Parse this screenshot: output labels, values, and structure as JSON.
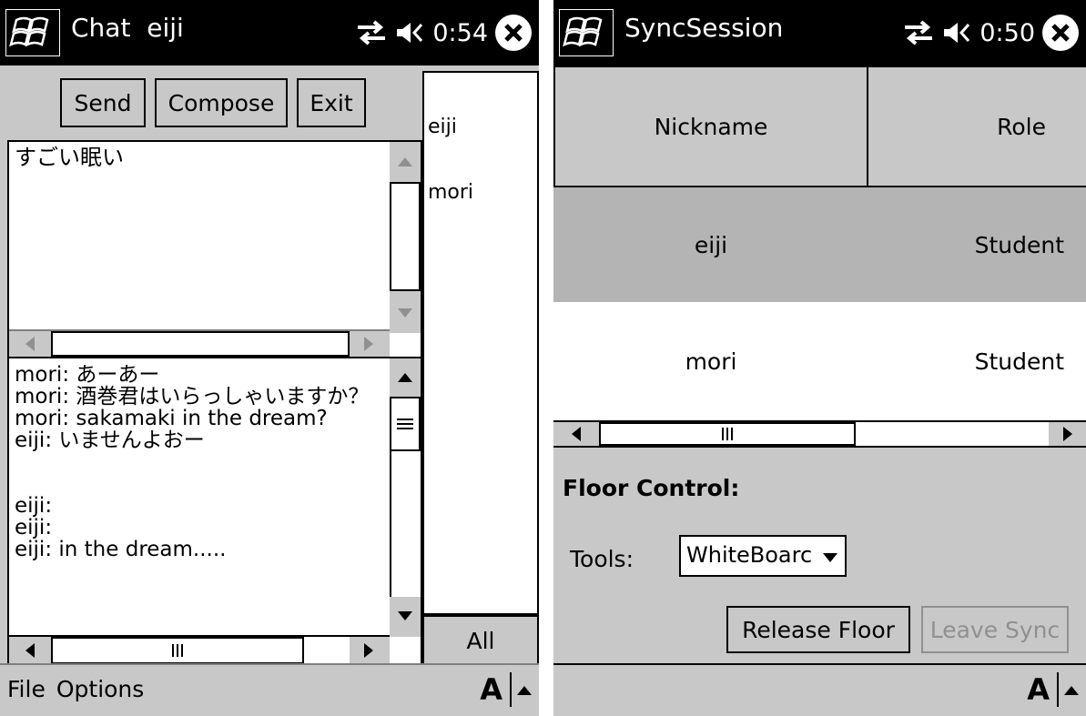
{
  "left": {
    "title": "Chat  eiji",
    "time": "0:54",
    "buttons": {
      "send": "Send",
      "compose": "Compose",
      "exit": "Exit"
    },
    "compose_text": "すごい眠い",
    "users": [
      "eiji",
      "mori"
    ],
    "all_label": "All",
    "messages": "mori: あーあー\nmori: 酒巻君はいらっしゃいますか？\nmori: sakamaki in the dream?\neiji: いませんよおー\n\n\neiji:\neiji:\neiji: in the dream.....",
    "menu": {
      "file": "File",
      "options": "Options"
    },
    "sip_label": "A"
  },
  "right": {
    "title": "SyncSession",
    "time": "0:50",
    "table": {
      "headers": [
        "Nickname",
        "Role"
      ],
      "rows": [
        {
          "nickname": "eiji",
          "role": "Student"
        },
        {
          "nickname": "mori",
          "role": "Student"
        }
      ]
    },
    "floor_control_label": "Floor Control:",
    "tools_label": "Tools:",
    "tools_value": "WhiteBoarc",
    "release_floor": "Release Floor",
    "leave_sync": "Leave Sync",
    "sip_label": "A"
  }
}
